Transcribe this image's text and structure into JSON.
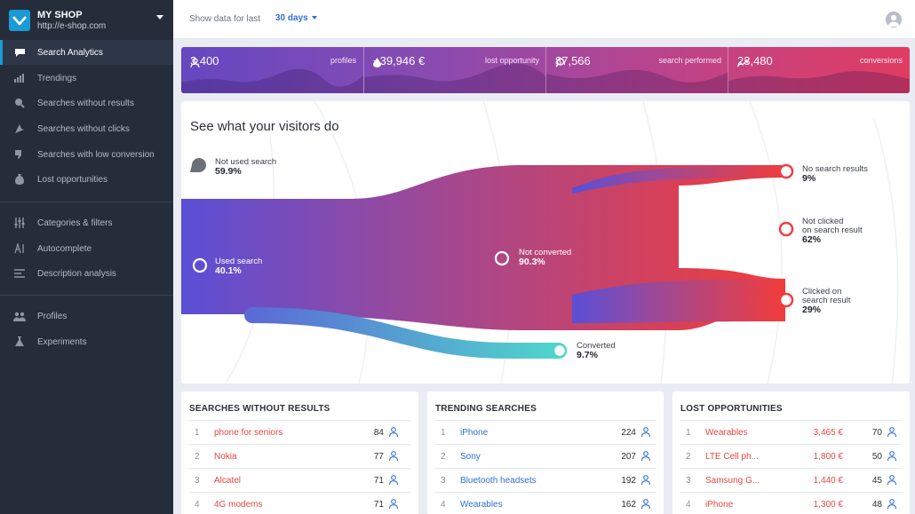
{
  "brand": {
    "name": "MY SHOP",
    "url": "http://e-shop.com"
  },
  "sidebar": {
    "items": [
      {
        "label": "Search Analytics",
        "icon": "chat-icon",
        "active": true
      },
      {
        "label": "Trendings",
        "icon": "bar-chart-icon"
      },
      {
        "label": "Searches without results",
        "icon": "search-x-icon"
      },
      {
        "label": "Searches without clicks",
        "icon": "cursor-off-icon"
      },
      {
        "label": "Searches with low conversion",
        "icon": "thumbs-down-icon"
      },
      {
        "label": "Lost opportunities",
        "icon": "money-bag-icon"
      },
      {
        "label": "Categories & filters",
        "icon": "sliders-icon"
      },
      {
        "label": "Autocomplete",
        "icon": "text-cursor-icon"
      },
      {
        "label": "Description analysis",
        "icon": "lines-icon"
      },
      {
        "label": "Profiles",
        "icon": "users-icon"
      },
      {
        "label": "Experiments",
        "icon": "flask-icon"
      }
    ]
  },
  "topbar": {
    "show_label": "Show data for last",
    "range": "30 days"
  },
  "stats": [
    {
      "value": "3,400",
      "label": "profiles",
      "icon": "user-icon"
    },
    {
      "value": "−39,946 €",
      "label": "lost opportunity",
      "icon": "money-drop-icon"
    },
    {
      "value": "87,566",
      "label": "search performed",
      "icon": "search-icon"
    },
    {
      "value": "23,480",
      "label": "conversions",
      "icon": "trend-up-icon"
    }
  ],
  "funnel": {
    "title": "See what your visitors do",
    "not_used": {
      "label": "Not used search",
      "pct": "59.9%"
    },
    "used": {
      "label": "Used search",
      "pct": "40.1%"
    },
    "not_converted": {
      "label": "Not converted",
      "pct": "90.3%"
    },
    "converted": {
      "label": "Converted",
      "pct": "9.7%"
    },
    "no_results": {
      "label": "No search results",
      "pct": "9%"
    },
    "not_clicked": {
      "label1": "Not clicked",
      "label2": "on search result",
      "pct": "62%"
    },
    "clicked": {
      "label1": "Clicked on",
      "label2": "search result",
      "pct": "29%"
    }
  },
  "panels": {
    "no_results": {
      "title": "SEARCHES WITHOUT RESULTS",
      "rows": [
        {
          "rank": "1",
          "term": "phone for seniors",
          "count": "84"
        },
        {
          "rank": "2",
          "term": "Nokia",
          "count": "77"
        },
        {
          "rank": "3",
          "term": "Alcatel",
          "count": "71"
        },
        {
          "rank": "4",
          "term": "4G modems",
          "count": "71"
        }
      ]
    },
    "trending": {
      "title": "TRENDING SEARCHES",
      "rows": [
        {
          "rank": "1",
          "term": "iPhone",
          "count": "224"
        },
        {
          "rank": "2",
          "term": "Sony",
          "count": "207"
        },
        {
          "rank": "3",
          "term": "Bluetooth headsets",
          "count": "192"
        },
        {
          "rank": "4",
          "term": "Wearables",
          "count": "162"
        }
      ]
    },
    "lost": {
      "title": "LOST OPPORTUNITIES",
      "rows": [
        {
          "rank": "1",
          "term": "Wearables",
          "amount": "3,465 €",
          "count": "70"
        },
        {
          "rank": "2",
          "term": "LTE Cell ph...",
          "amount": "1,800 €",
          "count": "50"
        },
        {
          "rank": "3",
          "term": "Samsung G...",
          "amount": "1,440 €",
          "count": "45"
        },
        {
          "rank": "4",
          "term": "iPhone",
          "amount": "1,300 €",
          "count": "48"
        }
      ]
    }
  },
  "colors": {
    "sidebar": "#252d3b",
    "accent": "#1b9ad6",
    "link": "#2f6fd8",
    "alert": "#e8473f",
    "teal": "#4fd6cc"
  }
}
